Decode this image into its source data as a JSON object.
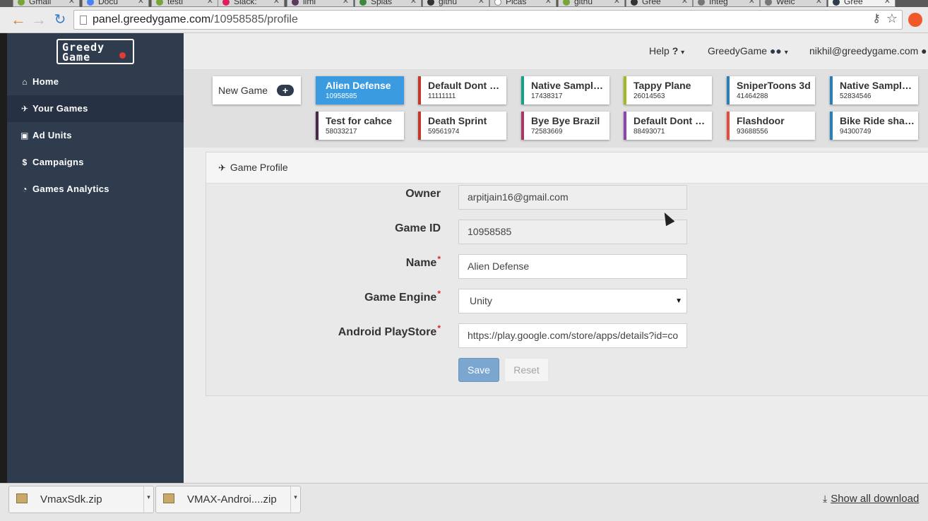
{
  "browser": {
    "tabs": [
      {
        "label": "Gmail"
      },
      {
        "label": "Docu"
      },
      {
        "label": "testi"
      },
      {
        "label": "Slack:"
      },
      {
        "label": "limi"
      },
      {
        "label": "Splas"
      },
      {
        "label": "githu"
      },
      {
        "label": "Picas"
      },
      {
        "label": "githu"
      },
      {
        "label": "Gree"
      },
      {
        "label": "Integ"
      },
      {
        "label": "Welc"
      },
      {
        "label": "Gree"
      }
    ],
    "url_host": "panel.greedygame.com",
    "url_path": "/10958585/profile"
  },
  "sidebar": {
    "logo": "Greedy Game",
    "items": [
      {
        "label": "Home",
        "icon": "home-icon"
      },
      {
        "label": "Your Games",
        "icon": "rocket-icon"
      },
      {
        "label": "Ad Units",
        "icon": "image-icon"
      },
      {
        "label": "Campaigns",
        "icon": "dollar-icon"
      },
      {
        "label": "Games Analytics",
        "icon": "dashboard-icon"
      }
    ]
  },
  "topbar": {
    "help": "Help",
    "help_icon": "?",
    "org": "GreedyGame",
    "user": "nikhil@greedygame.com"
  },
  "games": {
    "new_game": "New Game",
    "cards": [
      {
        "name": "Alien Defense",
        "id": "10958585",
        "color": "#3a9be0"
      },
      {
        "name": "Default Dont R...",
        "id": "11111111",
        "color": "#c0392b"
      },
      {
        "name": "Native Sample ...",
        "id": "17438317",
        "color": "#16a085"
      },
      {
        "name": "Tappy Plane",
        "id": "26014563",
        "color": "#a3b822"
      },
      {
        "name": "SniperToons 3d",
        "id": "41464288",
        "color": "#2980b9"
      },
      {
        "name": "Native Sample ...",
        "id": "52834546",
        "color": "#2980b9"
      },
      {
        "name": "Test for cahce",
        "id": "58033217",
        "color": "#4a2a4a"
      },
      {
        "name": "Death Sprint",
        "id": "59561974",
        "color": "#c0392b"
      },
      {
        "name": "Bye Bye Brazil",
        "id": "72583669",
        "color": "#a33a63"
      },
      {
        "name": "Default Dont re...",
        "id": "88493071",
        "color": "#8e44ad"
      },
      {
        "name": "Flashdoor",
        "id": "93688556",
        "color": "#e74c3c"
      },
      {
        "name": "Bike Ride shari...",
        "id": "94300749",
        "color": "#2980b9"
      }
    ]
  },
  "profile": {
    "title": "Game Profile",
    "owner_label": "Owner",
    "owner_value": "arpitjain16@gmail.com",
    "gameid_label": "Game ID",
    "gameid_value": "10958585",
    "name_label": "Name",
    "name_value": "Alien Defense",
    "engine_label": "Game Engine",
    "engine_value": "Unity",
    "playstore_label": "Android PlayStore",
    "playstore_value": "https://play.google.com/store/apps/details?id=co",
    "required_mark": "*",
    "save": "Save",
    "reset": "Reset"
  },
  "downloads": {
    "items": [
      {
        "label": "VmaxSdk.zip"
      },
      {
        "label": "VMAX-Androi....zip"
      }
    ],
    "show_all": "Show all download"
  }
}
